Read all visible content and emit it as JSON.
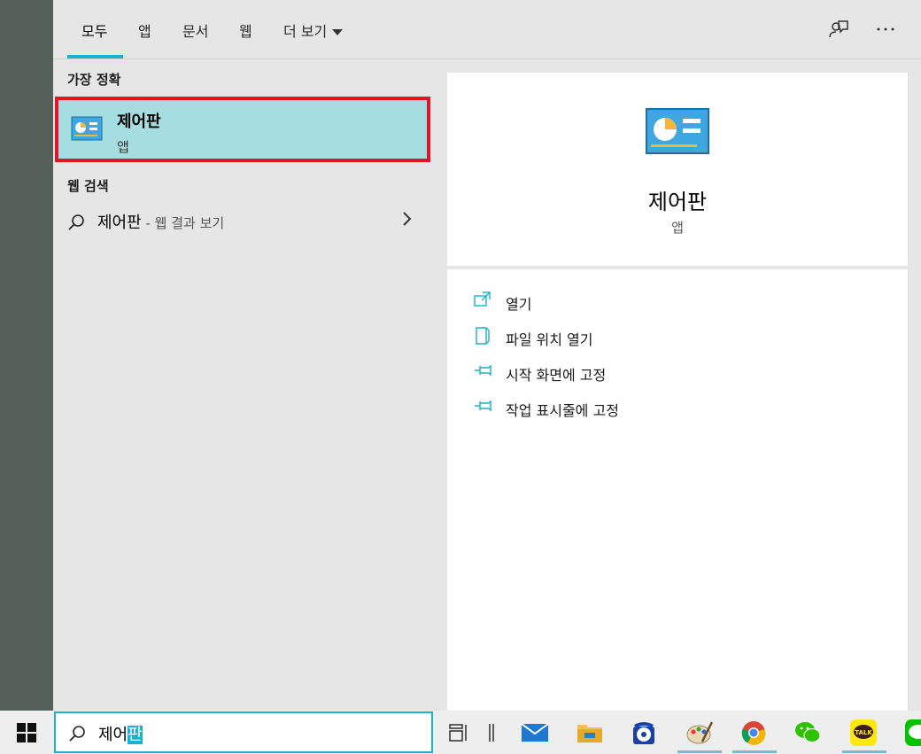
{
  "tabs": [
    "모두",
    "앱",
    "문서",
    "웹",
    "더 보기"
  ],
  "sections": {
    "best_match": "가장 정확",
    "web_search": "웹 검색"
  },
  "best_match": {
    "title": "제어판",
    "subtitle": "앱"
  },
  "web_result": {
    "query": "제어판",
    "suffix": " - 웹 결과 보기"
  },
  "detail": {
    "title": "제어판",
    "subtitle": "앱",
    "actions": [
      "열기",
      "파일 위치 열기",
      "시작 화면에 고정",
      "작업 표시줄에 고정"
    ]
  },
  "search": {
    "typed": "제어",
    "composing": "판"
  },
  "top_icons": [
    "feedback-icon",
    "more-options-icon"
  ],
  "taskbar_icons": [
    "task-view-icon",
    "mail-icon",
    "file-explorer-icon",
    "dial-phone-icon",
    "paint-icon",
    "chrome-icon",
    "wechat-icon",
    "kakaotalk-icon",
    "line-icon"
  ],
  "colors": {
    "accent": "#1ab3c9",
    "highlight": "#a6dde0",
    "selection_border": "#e0142b"
  }
}
